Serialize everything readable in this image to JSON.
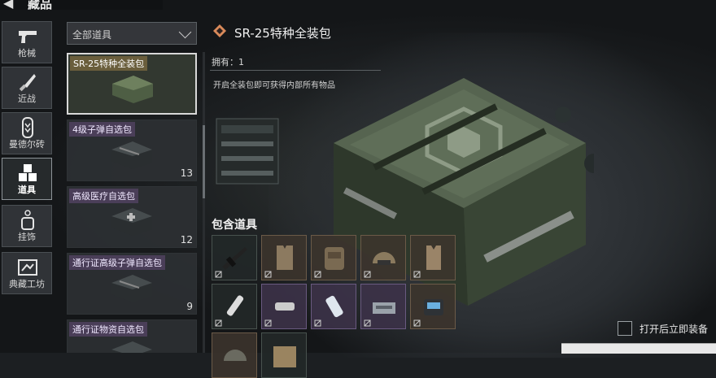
{
  "header": {
    "title": "藏品",
    "back_icon": "back-arrow-icon"
  },
  "nav": [
    {
      "label": "枪械",
      "icon": "pistol-icon",
      "active": false
    },
    {
      "label": "近战",
      "icon": "knife-icon",
      "active": false
    },
    {
      "label": "曼德尔砖",
      "icon": "brick-icon",
      "active": false
    },
    {
      "label": "道具",
      "icon": "cubes-icon",
      "active": true
    },
    {
      "label": "挂饰",
      "icon": "charm-icon",
      "active": false
    },
    {
      "label": "典藏工坊",
      "icon": "workshop-icon",
      "active": false
    }
  ],
  "filter": {
    "selected": "全部道具"
  },
  "items": [
    {
      "name": "SR-25特种全装包",
      "count": "",
      "selected": true
    },
    {
      "name": "4级子弹自选包",
      "count": "13",
      "selected": false
    },
    {
      "name": "高级医疗自选包",
      "count": "12",
      "selected": false
    },
    {
      "name": "通行证高级子弹自选包",
      "count": "9",
      "selected": false
    },
    {
      "name": "通行证物资自选包",
      "count": "",
      "selected": false
    }
  ],
  "detail": {
    "name": "SR-25特种全装包",
    "owned": "拥有：1",
    "description": "开启全装包即可获得内部所有物品",
    "contains_title": "包含道具",
    "contents": [
      {
        "icon": "rifle-icon",
        "tone": "dark"
      },
      {
        "icon": "vest-icon",
        "tone": "gold"
      },
      {
        "icon": "backpack-icon",
        "tone": "gold"
      },
      {
        "icon": "helmet-icon",
        "tone": "gold"
      },
      {
        "icon": "armor-icon",
        "tone": "gold"
      },
      {
        "icon": "syringe-icon",
        "tone": "dark"
      },
      {
        "icon": "bandage-icon",
        "tone": "purple"
      },
      {
        "icon": "medkit-icon",
        "tone": "purple"
      },
      {
        "icon": "ammo-box-icon",
        "tone": "purple"
      },
      {
        "icon": "battery-icon",
        "tone": "gold"
      },
      {
        "icon": "helmet-icon",
        "tone": "gold"
      },
      {
        "icon": "crate-icon",
        "tone": "dark"
      }
    ]
  },
  "auto_equip": {
    "label": "打开后立即装备",
    "checked": false
  },
  "colors": {
    "selected_border": "#d8d8d8",
    "gold_slot": "#3c342c",
    "purple_tag": "#4a3e58"
  }
}
